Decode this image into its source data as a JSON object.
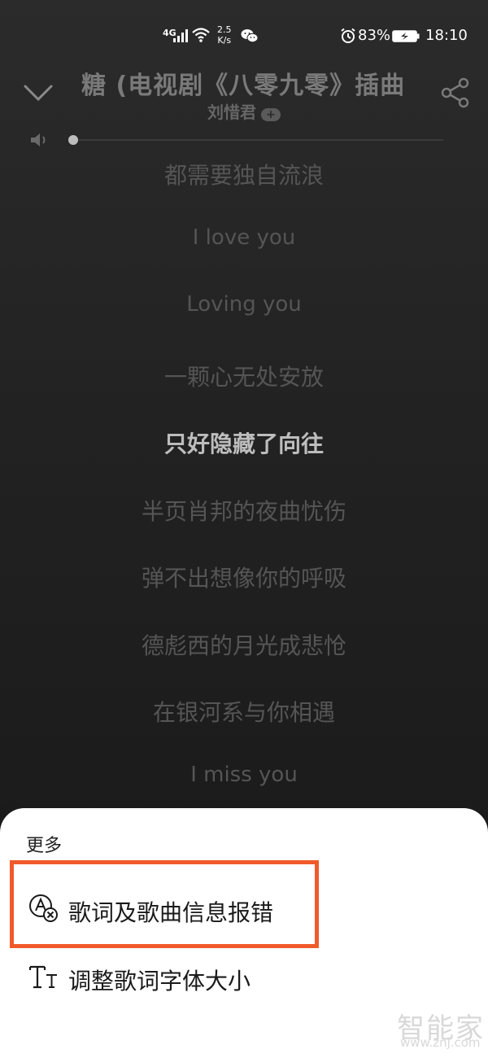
{
  "status_bar": {
    "network": "4G",
    "speed_value": "2.5",
    "speed_unit": "K/s",
    "battery_percent": "83%",
    "time": "18:10"
  },
  "player": {
    "title": "糖 (电视剧《八零九零》插曲",
    "artist": "刘惜君",
    "follow_label": "+",
    "volume_level": 0.0
  },
  "lyrics": [
    {
      "text": "都需要独自流浪",
      "active": false
    },
    {
      "text": "I love you",
      "active": false
    },
    {
      "text": "Loving you",
      "active": false
    },
    {
      "text": "一颗心无处安放",
      "active": false
    },
    {
      "text": "只好隐藏了向往",
      "active": true
    },
    {
      "text": "半页肖邦的夜曲忧伤",
      "active": false
    },
    {
      "text": "弹不出想像你的呼吸",
      "active": false
    },
    {
      "text": "德彪西的月光成悲怆",
      "active": false
    },
    {
      "text": "在银河系与你相遇",
      "active": false
    },
    {
      "text": "I miss you",
      "active": false
    }
  ],
  "sheet": {
    "title": "更多",
    "items": [
      {
        "label": "歌词及歌曲信息报错",
        "icon": "report-error-icon"
      },
      {
        "label": "调整歌词字体大小",
        "icon": "font-size-icon"
      }
    ]
  },
  "watermark": {
    "brand": "智能家",
    "url": "www.znj.com"
  },
  "colors": {
    "highlight": "#f05a2b",
    "background": "#222222",
    "active_lyric": "#bdbdbd",
    "inactive_lyric": "#555555"
  }
}
